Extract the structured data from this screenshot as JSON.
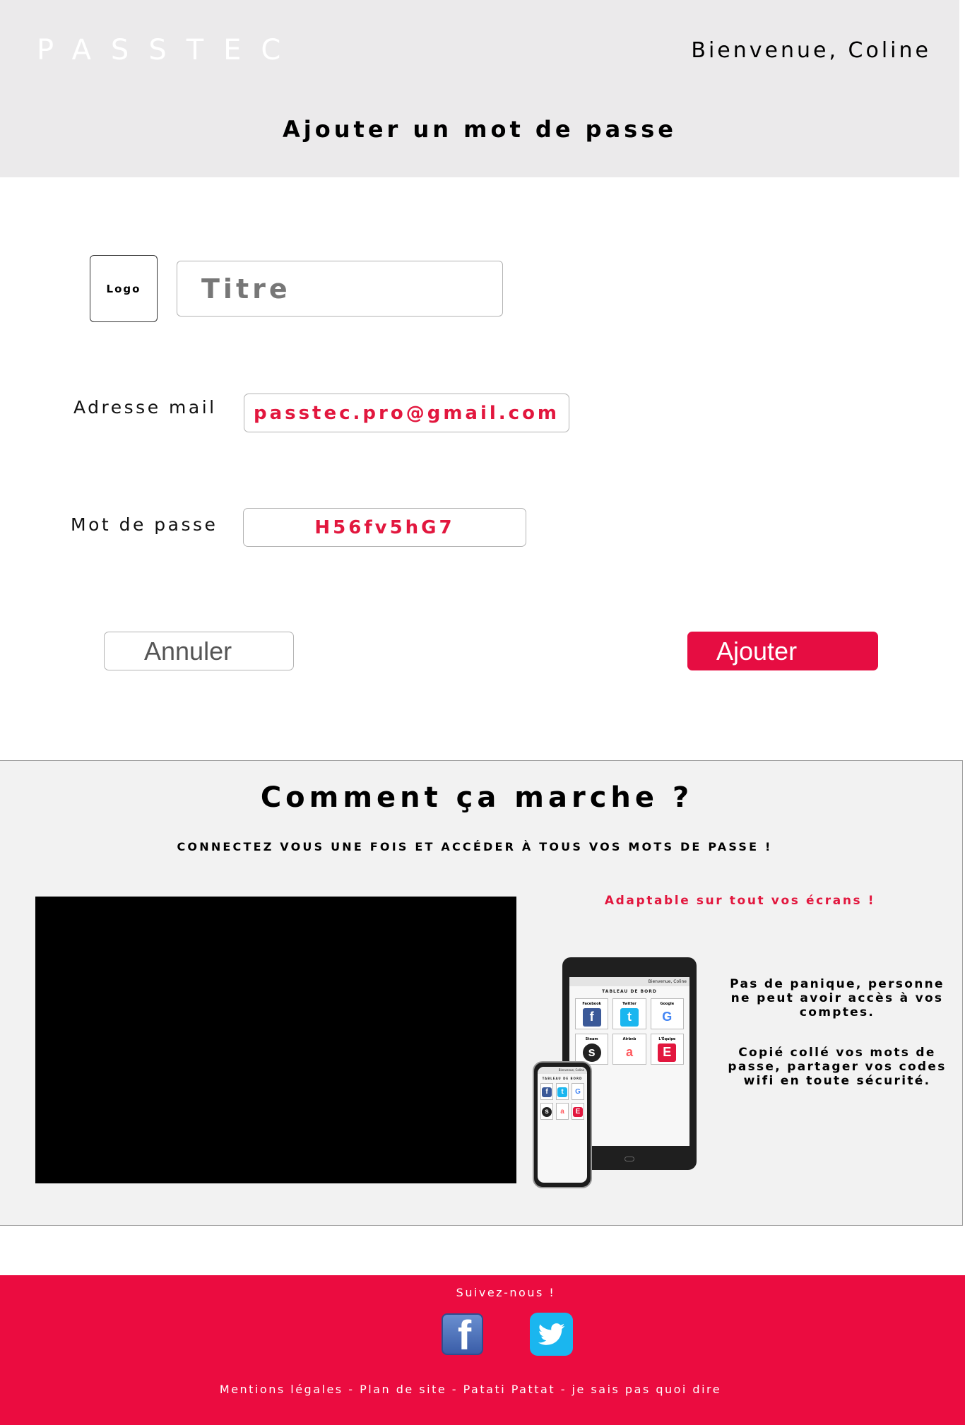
{
  "header": {
    "brand": "PASSTEC",
    "welcome": "Bienvenue, Coline",
    "page_title": "Ajouter un mot de passe"
  },
  "form": {
    "logo_label": "Logo",
    "title_placeholder": "Titre",
    "email_label": "Adresse mail",
    "email_value": "passtec.pro@gmail.com",
    "password_label": "Mot de passe",
    "password_value": "H56fv5hG7",
    "cancel_label": "Annuler",
    "add_label": "Ajouter"
  },
  "how": {
    "title": "Comment ça marche ?",
    "subtitle": "CONNECTEZ VOUS UNE FOIS ET ACCÉDER À TOUS VOS MOTS DE PASSE !",
    "adaptable": "Adaptable sur tout vos écrans !",
    "text_1": "Pas de panique, personne ne peut avoir accès à vos comptes.",
    "text_2": "Copié collé vos mots de passe, partager vos codes wifi en toute sécurité.",
    "device_preview": {
      "welcome": "Bienvenue, Coline",
      "title": "TABLEAU DE BORD",
      "tiles": [
        "Facebook",
        "Twitter",
        "Google",
        "Steam",
        "Airbnb",
        "L'Équipe"
      ]
    }
  },
  "footer": {
    "follow": "Suivez-nous !",
    "links": "Mentions légales - Plan de site - Patati Pattat - je sais pas quoi dire"
  },
  "colors": {
    "accent": "#e60d42",
    "header_bg": "#ebeaeb",
    "section_bg": "#f2f2f2",
    "footer_bg": "#eb0c40",
    "facebook": "#3b5998",
    "twitter": "#1ab6ef"
  },
  "icons": {
    "brand": "watermelon-icon",
    "facebook": "facebook-icon",
    "twitter": "twitter-icon"
  }
}
